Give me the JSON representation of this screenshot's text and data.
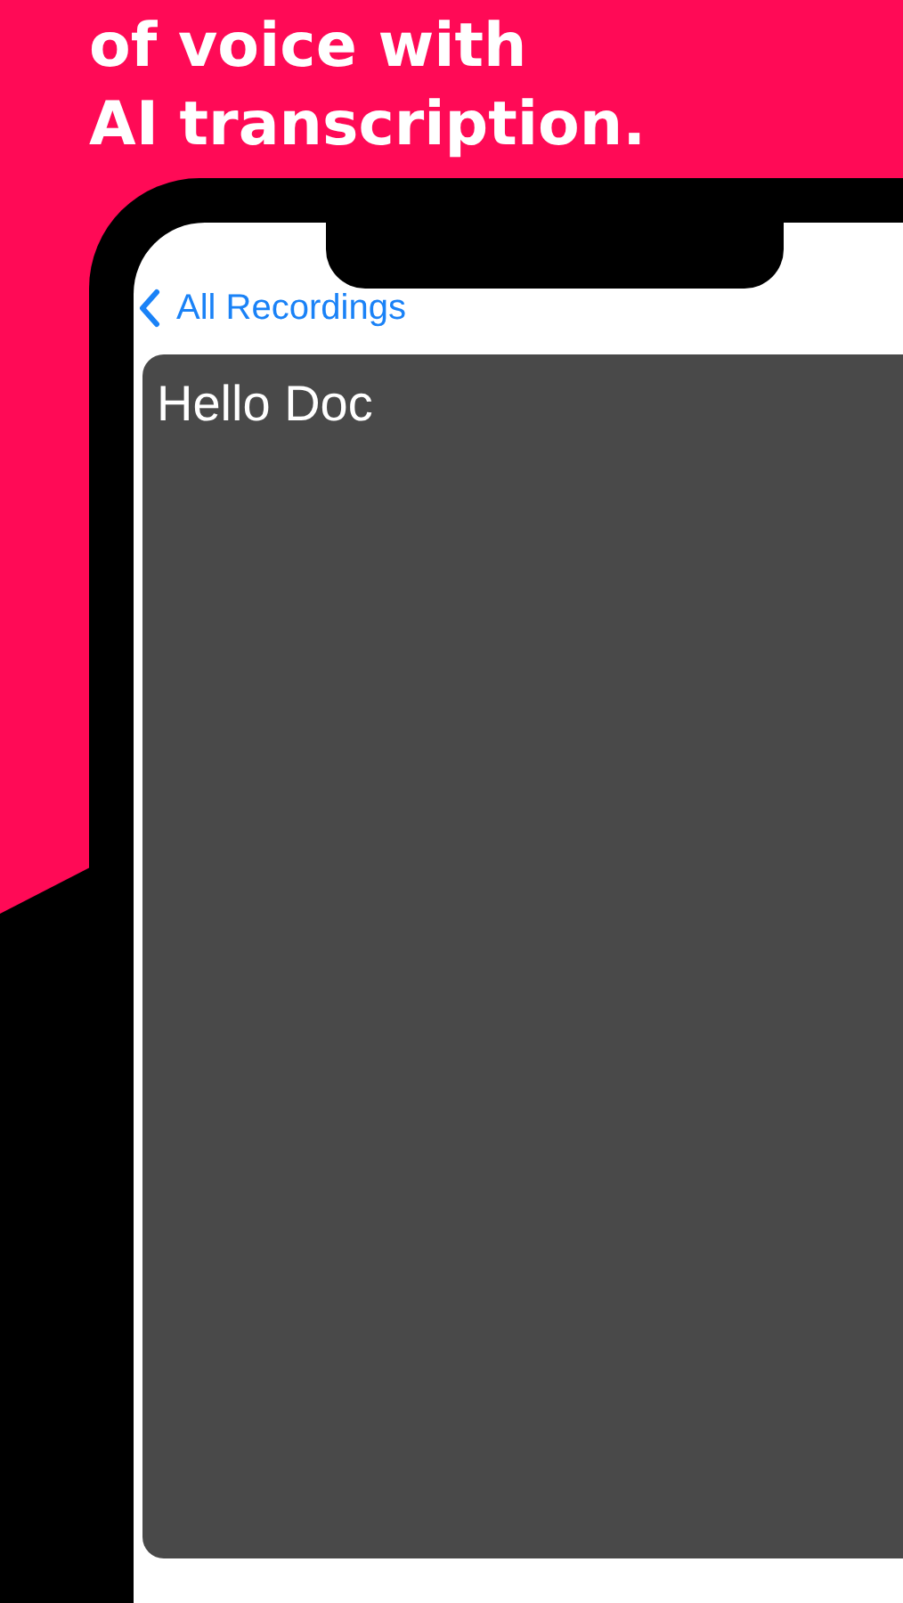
{
  "headline": [
    "of voice with",
    "AI transcription."
  ],
  "nav": {
    "back_label": "All Recordings"
  },
  "note": {
    "text": "Hello Doc"
  }
}
